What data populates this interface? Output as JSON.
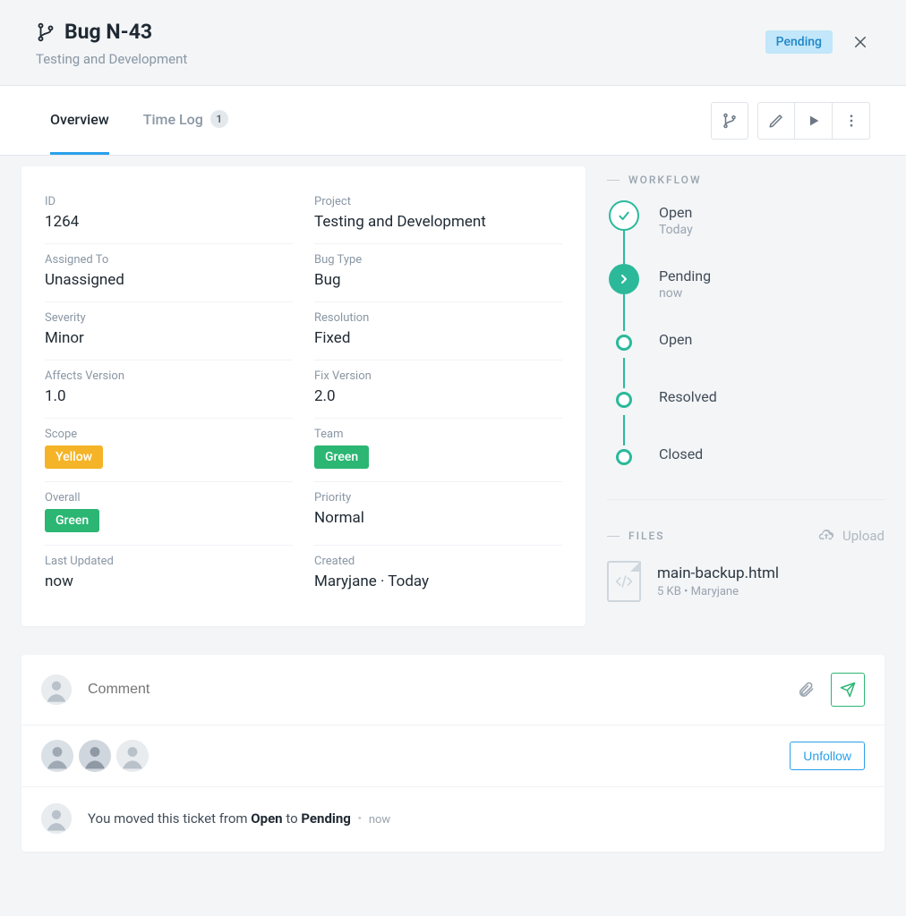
{
  "header": {
    "title": "Bug N-43",
    "subtitle": "Testing and Development",
    "status": "Pending"
  },
  "tabs": {
    "overview": "Overview",
    "timelog": "Time Log",
    "timelog_count": "1"
  },
  "details": {
    "id": {
      "label": "ID",
      "value": "1264"
    },
    "project": {
      "label": "Project",
      "value": "Testing and Development"
    },
    "assigned": {
      "label": "Assigned To",
      "value": "Unassigned"
    },
    "bugtype": {
      "label": "Bug Type",
      "value": "Bug"
    },
    "severity": {
      "label": "Severity",
      "value": "Minor"
    },
    "resolution": {
      "label": "Resolution",
      "value": "Fixed"
    },
    "affects": {
      "label": "Affects Version",
      "value": "1.0"
    },
    "fix": {
      "label": "Fix Version",
      "value": "2.0"
    },
    "scope": {
      "label": "Scope",
      "value": "Yellow"
    },
    "team": {
      "label": "Team",
      "value": "Green"
    },
    "overall": {
      "label": "Overall",
      "value": "Green"
    },
    "priority": {
      "label": "Priority",
      "value": "Normal"
    },
    "updated": {
      "label": "Last Updated",
      "value": "now"
    },
    "created": {
      "label": "Created",
      "value": "Maryjane · Today"
    }
  },
  "workflow": {
    "heading": "WORKFLOW",
    "steps": [
      {
        "title": "Open",
        "time": "Today"
      },
      {
        "title": "Pending",
        "time": "now"
      },
      {
        "title": "Open",
        "time": ""
      },
      {
        "title": "Resolved",
        "time": ""
      },
      {
        "title": "Closed",
        "time": ""
      }
    ]
  },
  "files": {
    "heading": "FILES",
    "upload_label": "Upload",
    "items": [
      {
        "name": "main-backup.html",
        "meta": "5 KB • Maryjane"
      }
    ]
  },
  "comment": {
    "placeholder": "Comment",
    "unfollow": "Unfollow"
  },
  "activity": {
    "prefix": "You moved this ticket from ",
    "from": "Open",
    "mid": " to ",
    "to": "Pending",
    "time": "now"
  }
}
